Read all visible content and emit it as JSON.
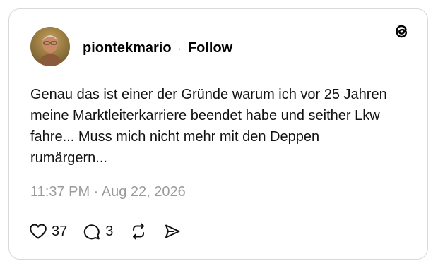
{
  "post": {
    "username": "piontekmario",
    "separator": "·",
    "follow_label": "Follow",
    "text": "Genau das ist einer der Gründe warum ich vor 25 Jahren meine Marktleiterkarriere beendet habe und seither Lkw fahre... Muss mich nicht mehr mit den Deppen rumärgern...",
    "timestamp": "11:37 PM · Aug 22, 2026"
  },
  "actions": {
    "likes_count": "37",
    "replies_count": "3"
  },
  "icons": {
    "brand": "threads-logo-icon",
    "like": "heart-icon",
    "reply": "comment-icon",
    "repost": "repost-icon",
    "share": "send-icon"
  },
  "colors": {
    "text": "#111111",
    "muted": "#9a9a9a",
    "border": "#d9d9d9"
  }
}
